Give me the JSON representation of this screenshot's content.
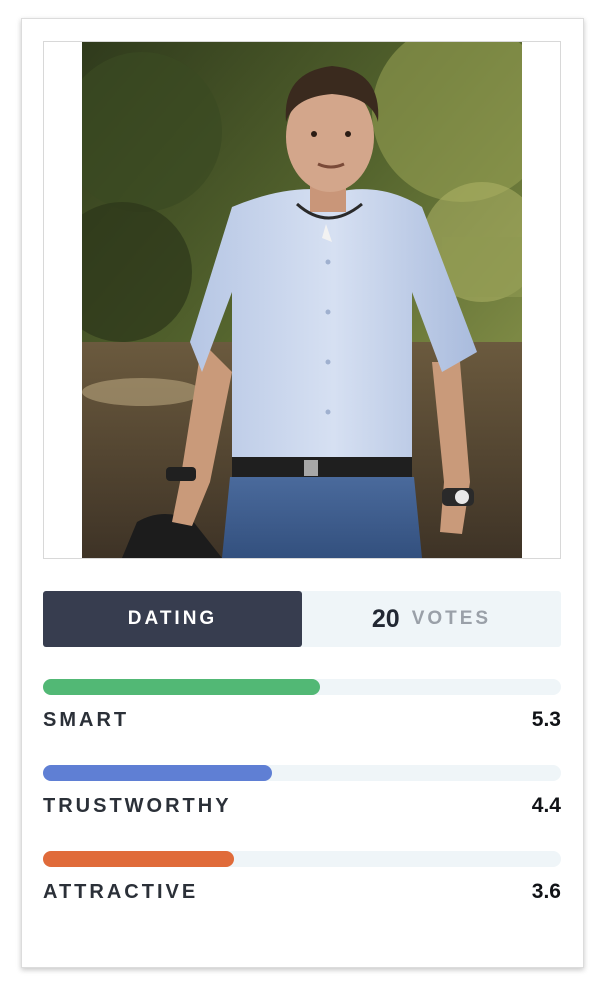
{
  "tab": {
    "label": "DATING"
  },
  "votes": {
    "count": "20",
    "label": "VOTES"
  },
  "photo": {
    "alt": "Profile photo"
  },
  "metrics": [
    {
      "label": "SMART",
      "value": "5.3",
      "fraction": 0.535,
      "color": "#52b875"
    },
    {
      "label": "TRUSTWORTHY",
      "value": "4.4",
      "fraction": 0.443,
      "color": "#5f7fd4"
    },
    {
      "label": "ATTRACTIVE",
      "value": "3.6",
      "fraction": 0.368,
      "color": "#e06b3a"
    }
  ]
}
